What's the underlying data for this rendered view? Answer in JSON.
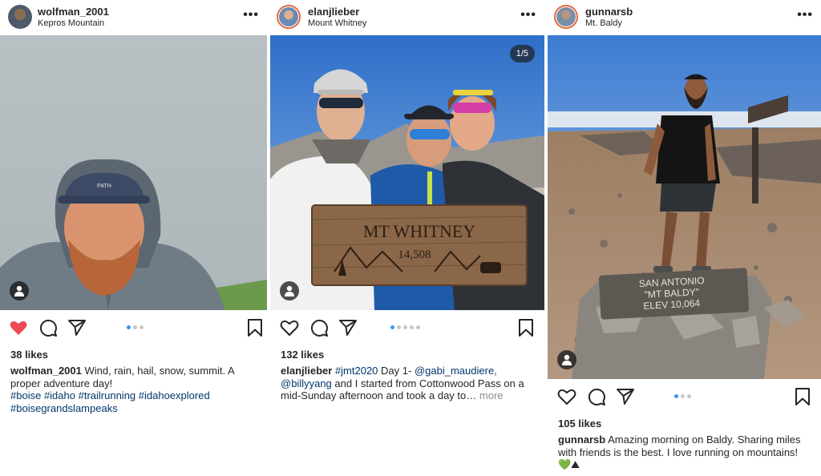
{
  "posts": [
    {
      "username": "wolfman_2001",
      "location": "Kepros Mountain",
      "likes": "38 likes",
      "caption_text": "Wind, rain, hail, snow, summit. A proper adventure day!",
      "hashtags": [
        "#boise",
        "#idaho",
        "#trailrunning",
        "#idahoexplored",
        "#boisegrandslampeaks"
      ],
      "liked": true,
      "carousel_dots": 3,
      "active_dot": 1
    },
    {
      "username": "elanjlieber",
      "location": "Mount Whitney",
      "badge": "1/5",
      "likes": "132 likes",
      "caption_tag": "#jmt2020",
      "caption_text1": "Day 1-",
      "mention1": "@gabi_maudiere,",
      "mention2": "@billyyang",
      "caption_text2": "and I started from Cottonwood Pass on a mid-Sunday afternoon and took a day to…",
      "more_label": "more",
      "sign_text_1": "MT WHITNEY",
      "sign_text_2": "14,508",
      "liked": false,
      "carousel_dots": 5,
      "active_dot": 1
    },
    {
      "username": "gunnarsb",
      "location": "Mt. Baldy",
      "likes": "105 likes",
      "caption_text": "Amazing morning on Baldy. Sharing miles with friends is the best. I love running on mountains!",
      "emoji": "💚⛰",
      "plaque_1": "SAN ANTONIO",
      "plaque_2": "\"MT BALDY\"",
      "plaque_3": "ELEV 10,064",
      "liked": false,
      "carousel_dots": 3,
      "active_dot": 1
    }
  ],
  "icons": {
    "more": "more-options-icon",
    "like": "heart-icon",
    "comment": "comment-icon",
    "share": "send-icon",
    "save": "bookmark-icon",
    "usertag": "user-tag-icon"
  },
  "colors": {
    "like_red": "#ed4956",
    "link_blue": "#00376b",
    "dot_active": "#3897f0",
    "muted": "#8e8e8e"
  }
}
